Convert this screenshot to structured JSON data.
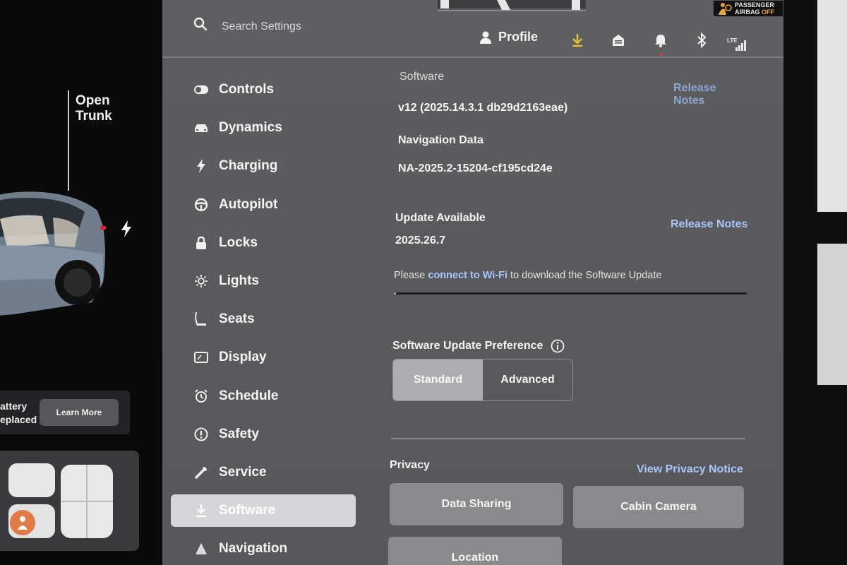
{
  "car_panel": {
    "trunk_label_line1": "Open",
    "trunk_label_line2": "Trunk",
    "battery_line1": "attery",
    "battery_line2": "eplaced",
    "learn_more_label": "Learn More"
  },
  "header": {
    "search_placeholder": "Search Settings",
    "profile_label": "Profile",
    "network_label": "LTE",
    "airbag_line1": "PASSENGER",
    "airbag_line2_prefix": "AIRBAG ",
    "airbag_line2_status": "OFF"
  },
  "sidebar": {
    "items": [
      {
        "label": "Controls",
        "icon": "toggle-icon"
      },
      {
        "label": "Dynamics",
        "icon": "car-icon"
      },
      {
        "label": "Charging",
        "icon": "bolt-icon"
      },
      {
        "label": "Autopilot",
        "icon": "steering-wheel-icon"
      },
      {
        "label": "Locks",
        "icon": "lock-icon"
      },
      {
        "label": "Lights",
        "icon": "sun-icon"
      },
      {
        "label": "Seats",
        "icon": "seat-icon"
      },
      {
        "label": "Display",
        "icon": "display-icon"
      },
      {
        "label": "Schedule",
        "icon": "alarm-clock-icon"
      },
      {
        "label": "Safety",
        "icon": "exclamation-circle-icon"
      },
      {
        "label": "Service",
        "icon": "wrench-icon"
      },
      {
        "label": "Software",
        "icon": "download-icon",
        "active": true
      },
      {
        "label": "Navigation",
        "icon": "navigation-arrow-icon"
      }
    ]
  },
  "software": {
    "section_label": "Software",
    "release_notes_label": "Release Notes",
    "version": "v12 (2025.14.3.1 db29d2163eae)",
    "nav_data_label": "Navigation Data",
    "nav_data_value": "NA-2025.2-15204-cf195cd24e",
    "update_label": "Update Available",
    "update_version": "2025.26.7",
    "update_release_notes_label": "Release Notes",
    "wifi_prefix": "Please ",
    "wifi_link": "connect to Wi-Fi",
    "wifi_suffix": " to download the Software Update",
    "download_progress": 0.005,
    "preference_label": "Software Update Preference",
    "preference_options": [
      "Standard",
      "Advanced"
    ],
    "preference_selected": "Standard"
  },
  "privacy": {
    "section_label": "Privacy",
    "notice_link": "View Privacy Notice",
    "buttons": [
      "Data Sharing",
      "Cabin Camera",
      "Location"
    ]
  },
  "colors": {
    "accent_link": "#a9c6ff",
    "progress": "#7fd39a",
    "airbag_off": "#e9a33a"
  }
}
